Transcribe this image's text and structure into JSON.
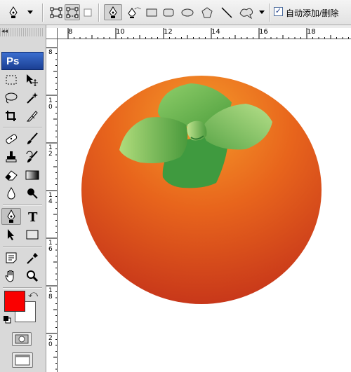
{
  "options_bar": {
    "tool_preset_icon": "pen-icon",
    "buttons": [
      {
        "name": "shape-layers-icon"
      },
      {
        "name": "paths-icon",
        "pressed": true
      },
      {
        "name": "fill-pixels-icon"
      },
      {
        "name": "pen-tool-option-icon",
        "pressed": true
      },
      {
        "name": "freeform-pen-icon"
      },
      {
        "name": "rectangle-shape-icon"
      },
      {
        "name": "rounded-rectangle-icon"
      },
      {
        "name": "ellipse-shape-icon"
      },
      {
        "name": "polygon-shape-icon"
      },
      {
        "name": "line-shape-icon"
      },
      {
        "name": "custom-shape-icon"
      }
    ],
    "auto_add_delete": {
      "checked": true,
      "label": "自动添加/删除"
    }
  },
  "toolbox": {
    "logo": "Ps",
    "active_tool": "pen-tool",
    "foreground_color": "#fa0000",
    "background_color": "#ffffff"
  },
  "document": {
    "h_ruler_labels": [
      "8",
      "10",
      "12",
      "14",
      "16",
      "18"
    ],
    "v_ruler_labels": [
      "8",
      "1 0",
      "1 2",
      "1 4",
      "1 6",
      "1 8",
      "2 0"
    ],
    "colors": {
      "fruit_light": "#f59a2a",
      "fruit_mid": "#e8651c",
      "fruit_dark": "#c4321a",
      "leaf_light": "#a6d57a",
      "leaf_dark": "#3f9a3f"
    }
  }
}
